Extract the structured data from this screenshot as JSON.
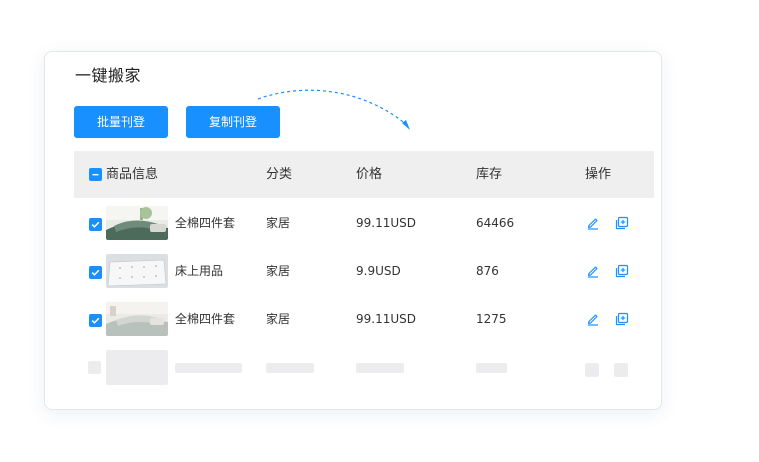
{
  "title": "一键搬家",
  "buttons": {
    "batch_label": "批量刊登",
    "copy_label": "复制刊登"
  },
  "table": {
    "headers": {
      "product": "商品信息",
      "category": "分类",
      "price": "价格",
      "stock": "库存",
      "actions": "操作"
    },
    "rows": [
      {
        "name": "全棉四件套",
        "category": "家居",
        "price": "99.11USD",
        "stock": "64466",
        "checked": true
      },
      {
        "name": "床上用品",
        "category": "家居",
        "price": "9.9USD",
        "stock": "876",
        "checked": true
      },
      {
        "name": "全棉四件套",
        "category": "家居",
        "price": "99.11USD",
        "stock": "1275",
        "checked": true
      }
    ]
  },
  "colors": {
    "accent": "#1890ff",
    "header_bg": "#efefef",
    "skeleton": "#ececef"
  },
  "icons": {
    "edit": "edit-icon",
    "copy": "copy-add-icon",
    "header_checkbox": "indeterminate-checkbox-icon",
    "row_checkbox": "checked-checkbox-icon"
  }
}
